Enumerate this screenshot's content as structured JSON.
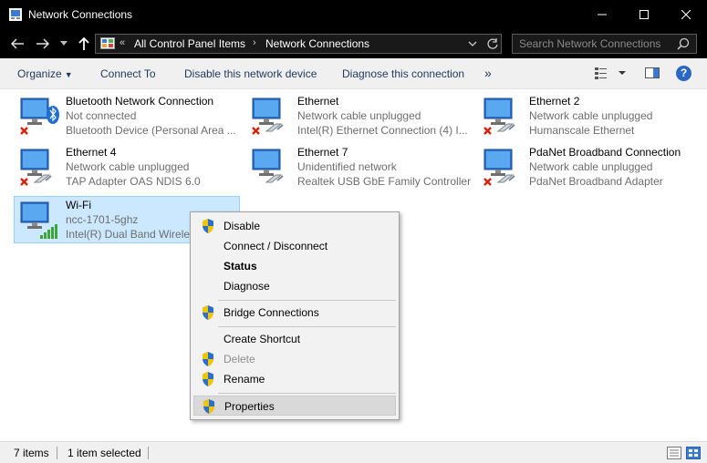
{
  "window": {
    "title": "Network Connections"
  },
  "nav": {
    "breadcrumb_overflow": "«",
    "crumbs": [
      "All Control Panel Items",
      "Network Connections"
    ],
    "separator": "›",
    "search_placeholder": "Search Network Connections"
  },
  "toolbar": {
    "organize": "Organize",
    "connect_to": "Connect To",
    "disable_device": "Disable this network device",
    "diagnose": "Diagnose this connection",
    "more": "»"
  },
  "connections": [
    {
      "name": "Bluetooth Network Connection",
      "status": "Not connected",
      "device": "Bluetooth Device (Personal Area ...",
      "kind": "bluetooth",
      "state": "disconnected"
    },
    {
      "name": "Ethernet",
      "status": "Network cable unplugged",
      "device": "Intel(R) Ethernet Connection (4) I...",
      "kind": "ethernet",
      "state": "unplugged"
    },
    {
      "name": "Ethernet 2",
      "status": "Network cable unplugged",
      "device": "Humanscale Ethernet",
      "kind": "ethernet",
      "state": "unplugged"
    },
    {
      "name": "Ethernet 4",
      "status": "Network cable unplugged",
      "device": "TAP Adapter OAS NDIS 6.0",
      "kind": "ethernet",
      "state": "unplugged"
    },
    {
      "name": "Ethernet 7",
      "status": "Unidentified network",
      "device": "Realtek USB GbE Family Controller",
      "kind": "ethernet",
      "state": "connected"
    },
    {
      "name": "PdaNet Broadband Connection",
      "status": "Network cable unplugged",
      "device": "PdaNet Broadband Adapter",
      "kind": "ethernet",
      "state": "unplugged"
    },
    {
      "name": "Wi-Fi",
      "status": "ncc-1701-5ghz",
      "device": "Intel(R) Dual Band Wireless",
      "kind": "wifi",
      "state": "connected",
      "selected": true
    }
  ],
  "context_menu": {
    "items": [
      {
        "label": "Disable",
        "shield": true
      },
      {
        "label": "Connect / Disconnect"
      },
      {
        "label": "Status",
        "bold": true
      },
      {
        "label": "Diagnose"
      },
      {
        "label": "Bridge Connections",
        "shield": true
      },
      {
        "label": "Create Shortcut"
      },
      {
        "label": "Delete",
        "shield": true,
        "disabled": true
      },
      {
        "label": "Rename",
        "shield": true
      },
      {
        "label": "Properties",
        "shield": true,
        "highlighted": true
      }
    ]
  },
  "statusbar": {
    "item_count": "7 items",
    "selection": "1 item selected"
  },
  "colors": {
    "titlebar": "#000000",
    "selection_bg": "#cce8ff",
    "command_text": "#1e395b",
    "error_red": "#d81e06",
    "help_blue": "#2b66c4"
  }
}
